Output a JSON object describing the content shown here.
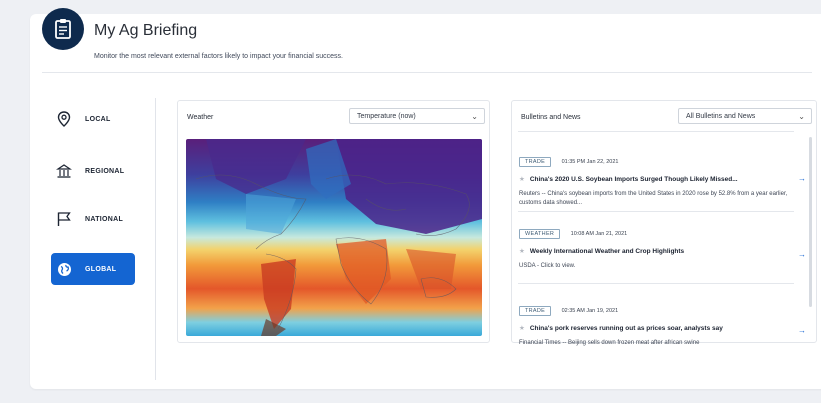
{
  "header": {
    "title": "My Ag Briefing",
    "subtitle": "Monitor the most relevant external factors likely to impact your financial success."
  },
  "nav": {
    "items": [
      {
        "label": "LOCAL",
        "icon": "location-pin-icon"
      },
      {
        "label": "REGIONAL",
        "icon": "building-icon"
      },
      {
        "label": "NATIONAL",
        "icon": "flag-icon"
      },
      {
        "label": "GLOBAL",
        "icon": "globe-icon",
        "active": true
      }
    ]
  },
  "weather": {
    "title": "Weather",
    "select_value": "Temperature (now)"
  },
  "news": {
    "title": "Bulletins and News",
    "select_value": "All Bulletins and News",
    "items": [
      {
        "badge": "TRADE",
        "timestamp": "01:35 PM Jan 22, 2021",
        "headline": "China's 2020 U.S. Soybean Imports Surged Though Likely Missed...",
        "snippet": "Reuters -- China's soybean imports from the United States in 2020 rose by 52.8% from a year earlier, customs data showed..."
      },
      {
        "badge": "WEATHER",
        "timestamp": "10:08 AM Jan 21, 2021",
        "headline": "Weekly International Weather and Crop Highlights",
        "snippet": "USDA - Click to view."
      },
      {
        "badge": "TRADE",
        "timestamp": "02:35 AM Jan 19, 2021",
        "headline": "China's pork reserves running out as prices soar, analysts say",
        "snippet": "Financial Times -- Beijing sells down frozen meat after african swine"
      }
    ]
  },
  "colors": {
    "brand": "#0e2a4d",
    "accent": "#1465d2"
  }
}
